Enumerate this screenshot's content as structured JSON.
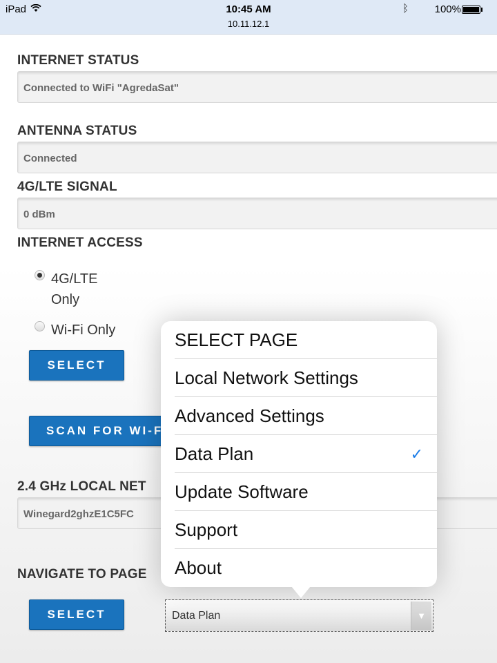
{
  "status_bar": {
    "device": "iPad",
    "time": "10:45 AM",
    "url": "10.11.12.1",
    "battery": "100%",
    "wifi_icon": "wifi-icon",
    "bluetooth_icon": "bluetooth-icon",
    "battery_level": 1.0
  },
  "internet_status": {
    "title": "INTERNET STATUS",
    "value": "Connected to WiFi \"AgredaSat\""
  },
  "antenna_status": {
    "title": "ANTENNA STATUS",
    "value": "Connected"
  },
  "lte_signal": {
    "title": "4G/LTE SIGNAL",
    "value": "0 dBm"
  },
  "internet_access": {
    "title": "INTERNET ACCESS",
    "options": [
      {
        "line1": "4G/LTE",
        "line2": "Only",
        "checked": true
      },
      {
        "line1": "Wi-Fi Only",
        "line2": "",
        "checked": false
      }
    ],
    "select_label": "SELECT"
  },
  "scan_button": "SCAN FOR WI-F",
  "local_network": {
    "title": "2.4 GHz LOCAL NET",
    "value": "Winegard2ghzE1C5FC"
  },
  "navigate": {
    "title": "NAVIGATE TO PAGE",
    "select_label": "SELECT",
    "selected": "Data Plan"
  },
  "popover": {
    "items": [
      {
        "label": "SELECT PAGE",
        "checked": false
      },
      {
        "label": "Local Network Settings",
        "checked": false
      },
      {
        "label": "Advanced Settings",
        "checked": false
      },
      {
        "label": "Data Plan",
        "checked": true
      },
      {
        "label": "Update Software",
        "checked": false
      },
      {
        "label": "Support",
        "checked": false
      },
      {
        "label": "About",
        "checked": false
      }
    ],
    "check_glyph": "✓"
  },
  "colors": {
    "button_blue": "#1a73bd",
    "checkmark_blue": "#1a7ce8",
    "status_bar_bg": "#dfe9f6"
  }
}
